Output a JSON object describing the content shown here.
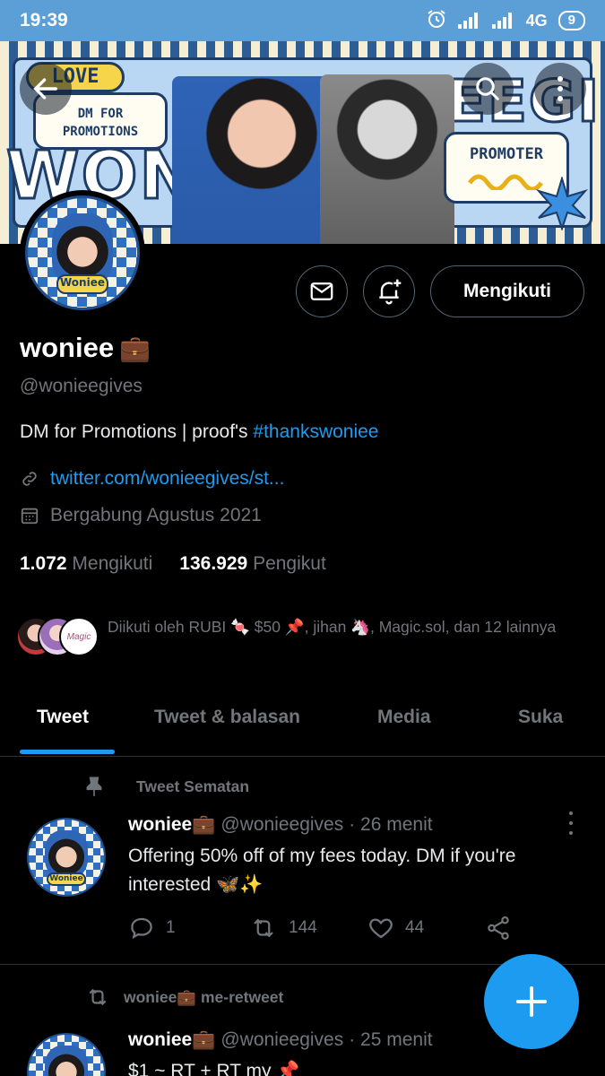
{
  "status_bar": {
    "time": "19:39",
    "network": "4G",
    "battery": "9"
  },
  "banner": {
    "text_dm": "DM FOR PROMOTIONS",
    "text_promoter": "PROMOTER",
    "text_love": "LOVE"
  },
  "profile": {
    "avatar_label": "Woniee",
    "name": "woniee",
    "name_emoji": "💼",
    "handle": "@wonieegives",
    "bio_text": "DM for Promotions | proof's ",
    "bio_hashtag": "#thankswoniee",
    "link": "twitter.com/wonieegives/st...",
    "joined": "Bergabung Agustus 2021",
    "following_count": "1.072",
    "following_label": "Mengikuti",
    "followers_count": "136.929",
    "followers_label": "Pengikut",
    "followed_by": "Diikuti oleh RUBI 🍬 $50 📌, jihan 🦄, Magic.sol, dan 12 lainnya",
    "mini_avatar_text": "Magic"
  },
  "actions": {
    "follow_button": "Mengikuti"
  },
  "tabs": [
    {
      "label": "Tweet",
      "active": true
    },
    {
      "label": "Tweet & balasan",
      "active": false
    },
    {
      "label": "Media",
      "active": false
    },
    {
      "label": "Suka",
      "active": false
    }
  ],
  "tweets": [
    {
      "context": "Tweet Sematan",
      "name": "woniee💼",
      "handle": "@wonieegives",
      "time": "· 26 menit",
      "text": "Offering 50% off of my fees today. DM if you're interested 🦋✨",
      "replies": "1",
      "retweets": "144",
      "likes": "44"
    },
    {
      "context": "woniee💼 me-retweet",
      "name": "woniee💼",
      "handle": "@wonieegives",
      "time": "· 25 menit",
      "text": "$1 ~ RT + RT my 📌"
    }
  ],
  "colors": {
    "accent": "#1d9bf0",
    "background": "#000000",
    "muted": "#71767b",
    "status_bar": "#5c9ed6"
  }
}
